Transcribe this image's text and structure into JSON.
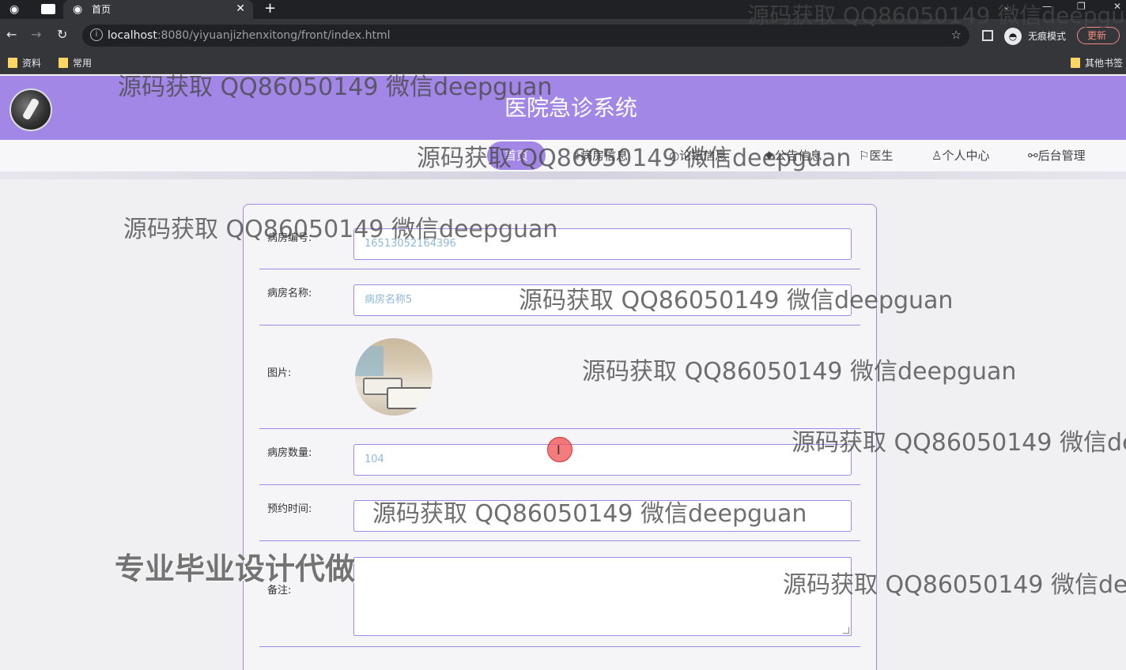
{
  "browser": {
    "tab_title": "首页",
    "tab_close": "✕",
    "new_tab": "+",
    "url_host": "localhost",
    "url_rest": ":8080/yiyuanjizhenxitong/front/index.html",
    "incognito_label": "无痕模式",
    "update_label": "更新",
    "bookmarks": [
      "资料",
      "常用",
      "其他书签"
    ]
  },
  "site": {
    "title": "医院急诊系统",
    "nav": [
      {
        "label": "首页",
        "icon": "home-icon"
      },
      {
        "label": "病房信息",
        "icon": "bed-icon"
      },
      {
        "label": "论坛信息",
        "icon": "forum-icon"
      },
      {
        "label": "公告信息",
        "icon": "notice-icon"
      },
      {
        "label": "医生",
        "icon": "flag-icon"
      },
      {
        "label": "个人中心",
        "icon": "user-icon"
      },
      {
        "label": "后台管理",
        "icon": "link-icon"
      }
    ]
  },
  "form": {
    "fields": [
      {
        "label": "病房编号:",
        "value": "16513052164396"
      },
      {
        "label": "病房名称:",
        "value": "病房名称5"
      },
      {
        "label": "图片:"
      },
      {
        "label": "病房数量:",
        "value": "104"
      },
      {
        "label": "预约时间:",
        "value": ""
      },
      {
        "label": "备注:",
        "value": ""
      }
    ]
  },
  "watermarks": {
    "contact": "源码获取 QQ86050149 微信deepguan",
    "service": "专业毕业设计代做"
  },
  "colors": {
    "accent": "#a287e6",
    "input_text": "#8fb8d8"
  }
}
